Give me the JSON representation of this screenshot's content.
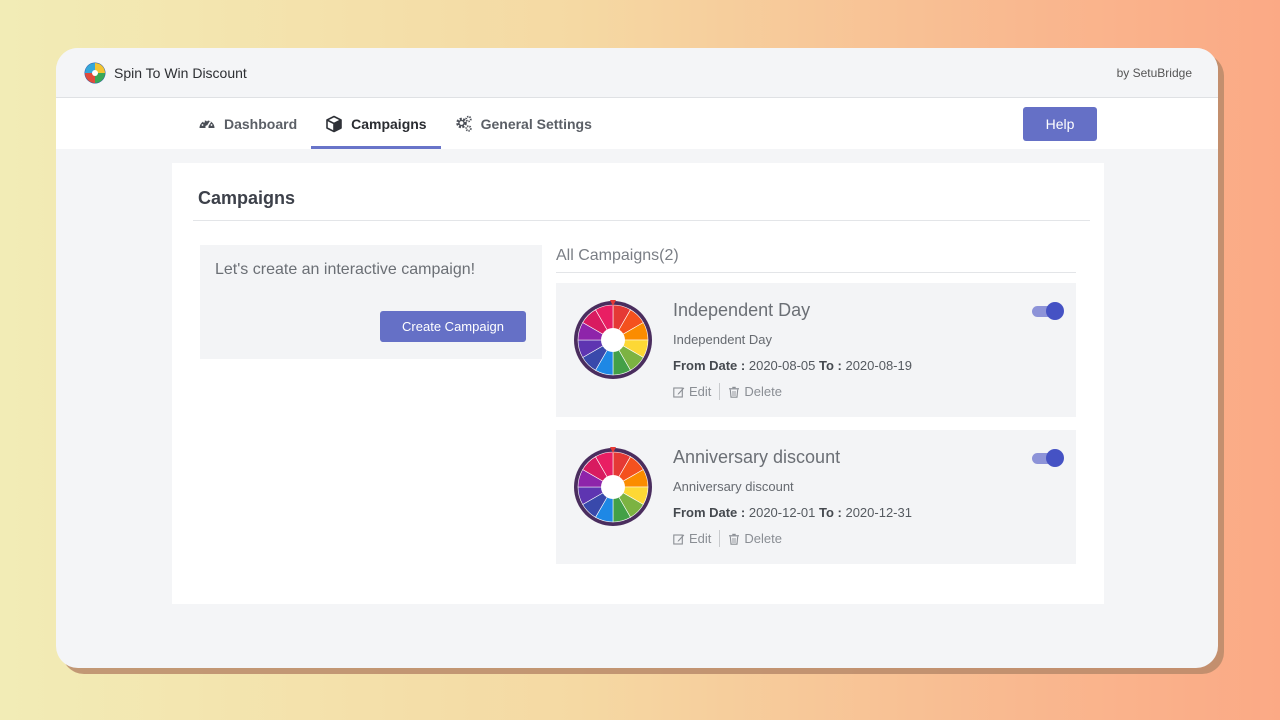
{
  "app": {
    "title": "Spin To Win Discount",
    "by": "by SetuBridge"
  },
  "nav": {
    "tabs": [
      {
        "label": "Dashboard",
        "icon": "dashboard-gauge-icon",
        "active": false
      },
      {
        "label": "Campaigns",
        "icon": "cube-icon",
        "active": true
      },
      {
        "label": "General Settings",
        "icon": "gears-icon",
        "active": false
      }
    ],
    "help_label": "Help"
  },
  "page": {
    "title": "Campaigns",
    "create": {
      "prompt": "Let's create an interactive campaign!",
      "button_label": "Create Campaign"
    },
    "all_campaigns_title": "All Campaigns(2)",
    "campaigns": [
      {
        "name": "Independent Day",
        "description": "Independent Day",
        "from_label": "From Date :",
        "from_date": "2020-08-05",
        "to_label": "To :",
        "to_date": "2020-08-19",
        "enabled": true,
        "edit_label": "Edit",
        "delete_label": "Delete"
      },
      {
        "name": "Anniversary discount",
        "description": "Anniversary discount",
        "from_label": "From Date :",
        "from_date": "2020-12-01",
        "to_label": "To :",
        "to_date": "2020-12-31",
        "enabled": true,
        "edit_label": "Edit",
        "delete_label": "Delete"
      }
    ]
  },
  "colors": {
    "accent": "#6570c6",
    "toggle_on": "#4552c4",
    "wheel_segments": [
      "#e53935",
      "#f4511e",
      "#fb8c00",
      "#fdd835",
      "#7cb342",
      "#43a047",
      "#1e88e5",
      "#3949ab",
      "#5e35b1",
      "#8e24aa",
      "#d81b60",
      "#e91e63"
    ],
    "wheel_rim": "#4a2d5e"
  }
}
